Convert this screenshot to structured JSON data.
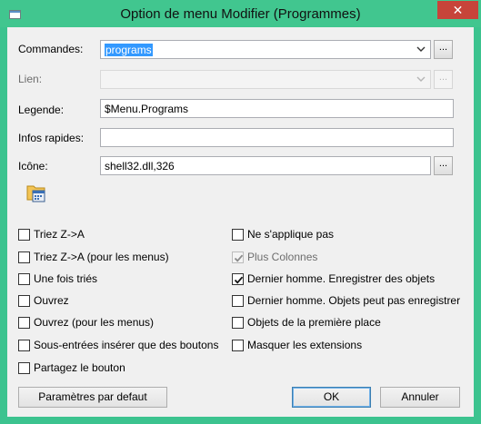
{
  "window": {
    "title": "Option de menu Modifier (Programmes)",
    "close_label": "✕"
  },
  "form": {
    "commandes": {
      "label": "Commandes:",
      "value": "programs",
      "browse": "..."
    },
    "lien": {
      "label": "Lien:",
      "value": "",
      "browse": "..."
    },
    "legende": {
      "label": "Legende:",
      "value": "$Menu.Programs"
    },
    "infos": {
      "label": "Infos rapides:",
      "value": ""
    },
    "icone": {
      "label": "Icône:",
      "value": "shell32.dll,326",
      "browse": "..."
    },
    "preview_icon": "programs-folder-icon"
  },
  "options_left": [
    {
      "label": "Triez Z->A",
      "checked": false
    },
    {
      "label": "Triez Z->A (pour les menus)",
      "checked": false
    },
    {
      "label": "Une fois triés",
      "checked": false
    },
    {
      "label": "Ouvrez",
      "checked": false
    },
    {
      "label": "Ouvrez (pour les menus)",
      "checked": false
    },
    {
      "label": "Sous-entrées insérer que des boutons",
      "checked": false
    },
    {
      "label": "Partagez le bouton",
      "checked": false
    }
  ],
  "options_right": [
    {
      "label": "Ne s'applique pas",
      "checked": false,
      "disabled": false
    },
    {
      "label": "Plus Colonnes",
      "checked": true,
      "disabled": true
    },
    {
      "label": "Dernier homme. Enregistrer des objets",
      "checked": true,
      "disabled": false
    },
    {
      "label": "Dernier homme. Objets peut pas enregistrer",
      "checked": false,
      "disabled": false
    },
    {
      "label": "Objets de la première place",
      "checked": false,
      "disabled": false
    },
    {
      "label": "Masquer les extensions",
      "checked": false,
      "disabled": false
    }
  ],
  "buttons": {
    "defaults": "Paramètres par defaut",
    "ok": "OK",
    "cancel": "Annuler"
  },
  "colors": {
    "titlebar": "#41c68f",
    "close": "#c7443a",
    "selection": "#3399ff",
    "dialog": "#f0f0f0"
  }
}
